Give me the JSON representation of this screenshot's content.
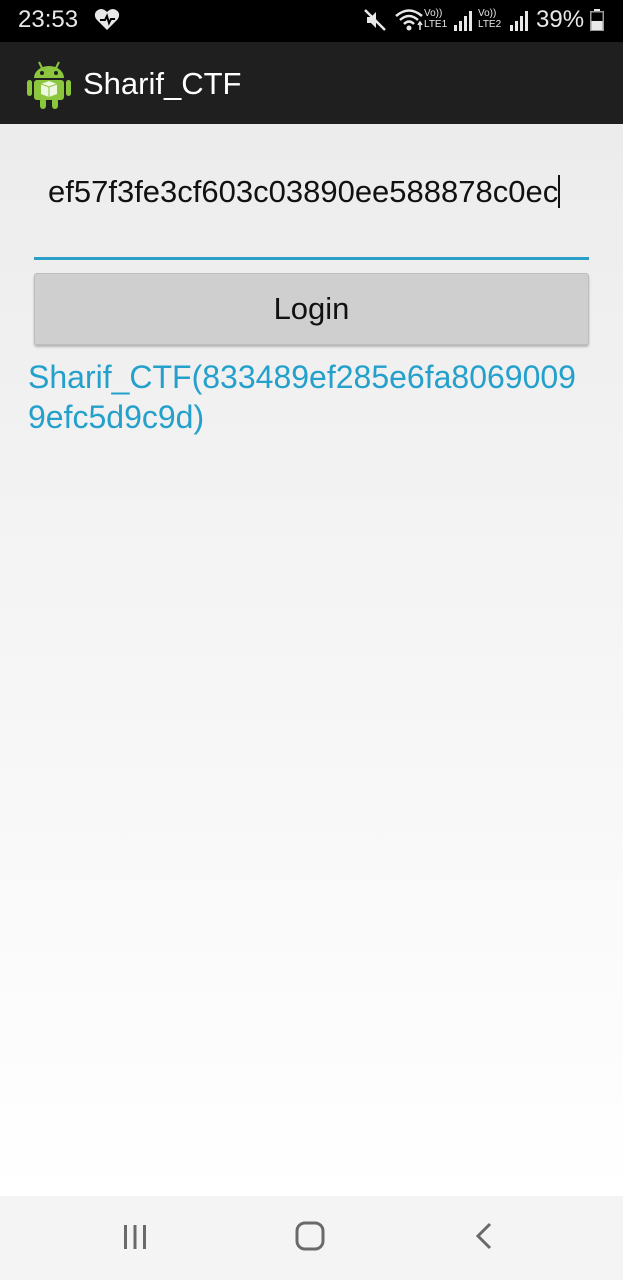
{
  "status_bar": {
    "time": "23:53",
    "sim1_label_top": "Vo))",
    "sim1_label_bottom": "LTE1",
    "sim2_label_top": "Vo))",
    "sim2_label_bottom": "LTE2",
    "battery": "39%",
    "icons": [
      "heart-icon",
      "mute-icon",
      "wifi-icon",
      "signal-icon",
      "signal-icon",
      "battery-icon"
    ]
  },
  "app_bar": {
    "title": "Sharif_CTF",
    "icon": "android-icon"
  },
  "form": {
    "input_value": "ef57f3fe3cf603c03890ee588878c0ec",
    "login_label": "Login",
    "result_text": "Sharif_CTF(833489ef285e6fa80690099efc5d9c9d)"
  },
  "nav_bar": {
    "icons": [
      "recents-icon",
      "home-icon",
      "back-icon"
    ]
  },
  "colors": {
    "accent": "#2a9fc9",
    "result_text": "#23a0cc",
    "app_bar": "#1f1f1f",
    "status_bar": "#000000"
  }
}
